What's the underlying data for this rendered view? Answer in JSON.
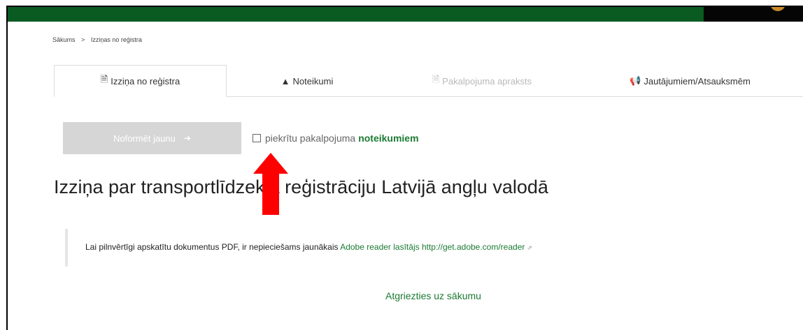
{
  "breadcrumb": {
    "home": "Sākums",
    "separator": ">",
    "current": "Izziņas no reģistra"
  },
  "tabs": [
    {
      "icon": "🗎",
      "label": "Izziņa no reģistra"
    },
    {
      "icon": "▲",
      "label": "Noteikumi"
    },
    {
      "icon": "🗎",
      "label": "Pakalpojuma apraksts"
    },
    {
      "icon": "📢",
      "label": "Jautājumiem/Atsauksmēm"
    }
  ],
  "actions": {
    "new_button_label": "Noformēt jaunu",
    "new_button_arrow": "➜"
  },
  "agreement": {
    "text": "piekrītu pakalpojuma",
    "link": "noteikumiem"
  },
  "page": {
    "title": "Izziņa par transportlīdzekļa reģistrāciju Latvijā angļu valodā"
  },
  "notice": {
    "text": "Lai pilnvērtīgi apskatītu dokumentus PDF, ir nepieciešams jaunākais",
    "link": "Adobe reader lasītājs http://get.adobe.com/reader",
    "ext_icon": "⇗"
  },
  "footer": {
    "back_link": "Atgriezties uz sākumu"
  },
  "colors": {
    "brand_green": "#0a5b22",
    "link_green": "#1c7a33",
    "annotation_red": "#ff0000"
  }
}
